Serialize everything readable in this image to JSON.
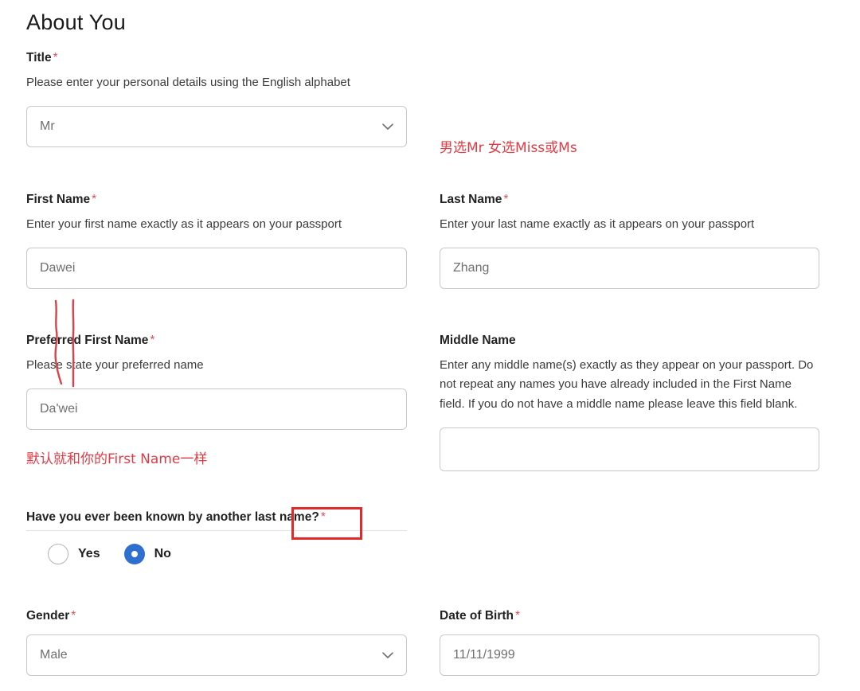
{
  "page": {
    "title": "About You"
  },
  "fields": {
    "title": {
      "label": "Title",
      "required_mark": "*",
      "help": "Please enter your personal details using the English alphabet",
      "value": "Mr",
      "icon": "chevron-down-icon"
    },
    "first_name": {
      "label": "First Name",
      "required_mark": "*",
      "help": "Enter your first name exactly as it appears on your passport",
      "value": "Dawei"
    },
    "last_name": {
      "label": "Last Name",
      "required_mark": "*",
      "help": "Enter your last name exactly as it appears on your passport",
      "value": "Zhang"
    },
    "preferred_first_name": {
      "label": "Preferred First Name",
      "required_mark": "*",
      "help": "Please state your preferred name",
      "value": "Da'wei"
    },
    "middle_name": {
      "label": "Middle Name",
      "required_mark": "",
      "help": "Enter any middle name(s) exactly as they appear on your passport. Do not repeat any names you have already included in the First Name field. If you do not have a middle name please leave this field blank.",
      "value": ""
    },
    "another_last_name": {
      "label": "Have you ever been known by another last name?",
      "required_mark": "*",
      "options": [
        {
          "label": "Yes",
          "selected": false
        },
        {
          "label": "No",
          "selected": true
        }
      ]
    },
    "gender": {
      "label": "Gender",
      "required_mark": "*",
      "value": "Male",
      "icon": "chevron-down-icon"
    },
    "date_of_birth": {
      "label": "Date of Birth",
      "required_mark": "*",
      "value": "11/11/1999"
    }
  },
  "annotations": [
    {
      "id": "title-note",
      "text": "男选Mr 女选Miss或Ms"
    },
    {
      "id": "preferred-note",
      "text": "默认就和你的First Name一样"
    }
  ],
  "colors": {
    "required_asterisk": "#d8505a",
    "annotation_red": "#e03b44",
    "highlight_red": "#e02b2b",
    "radio_selected": "#2f6fd0",
    "input_border": "#c9c9c9"
  }
}
